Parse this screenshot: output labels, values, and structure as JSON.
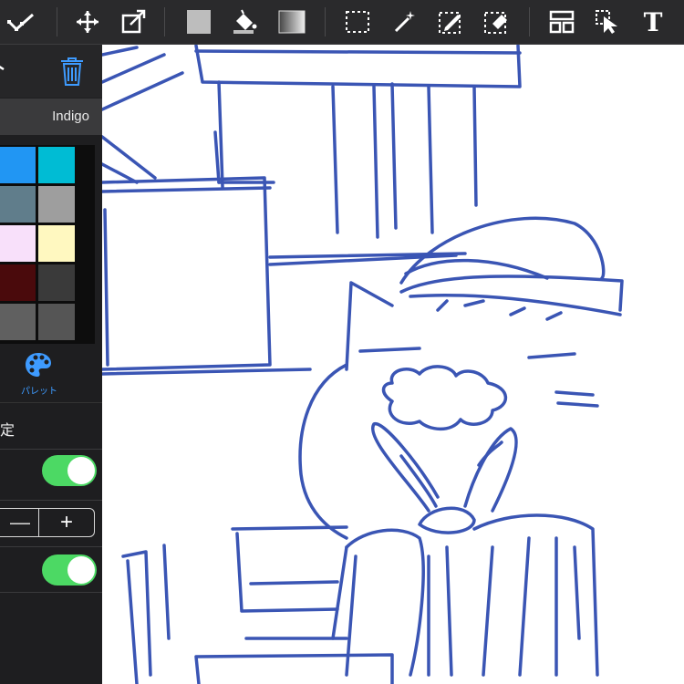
{
  "colors": {
    "accent": "#3e9bff",
    "toggle_on": "#4cd964",
    "stroke": "#3a55b4",
    "toolbar_bg": "#2a2a2c"
  },
  "toolbar": {
    "tools": [
      "vertex-edit-icon",
      "move-icon",
      "transform-icon",
      "fill-color-icon",
      "bucket-icon",
      "gradient-icon",
      "rect-select-icon",
      "magic-wand-icon",
      "selection-pen-icon",
      "selection-eraser-icon",
      "layout-icon",
      "select-pointer-icon",
      "text-tool-icon"
    ],
    "text_tool_glyph": "T"
  },
  "panel": {
    "color_name": "Indigo",
    "swatches": [
      "#3f51b5",
      "#2196f3",
      "#00bcd4",
      "#ff9800",
      "#607d8b",
      "#9e9e9e",
      "#e0a886",
      "#f8e0fa",
      "#fff8c0",
      "#ffe9d6",
      "#4a0a0c",
      "#3a3a3a",
      "#555555",
      "#606060",
      "#555555"
    ],
    "palette_label": "パレット",
    "settings_heading": "定",
    "stepper_minus": "—",
    "stepper_plus": "+"
  }
}
